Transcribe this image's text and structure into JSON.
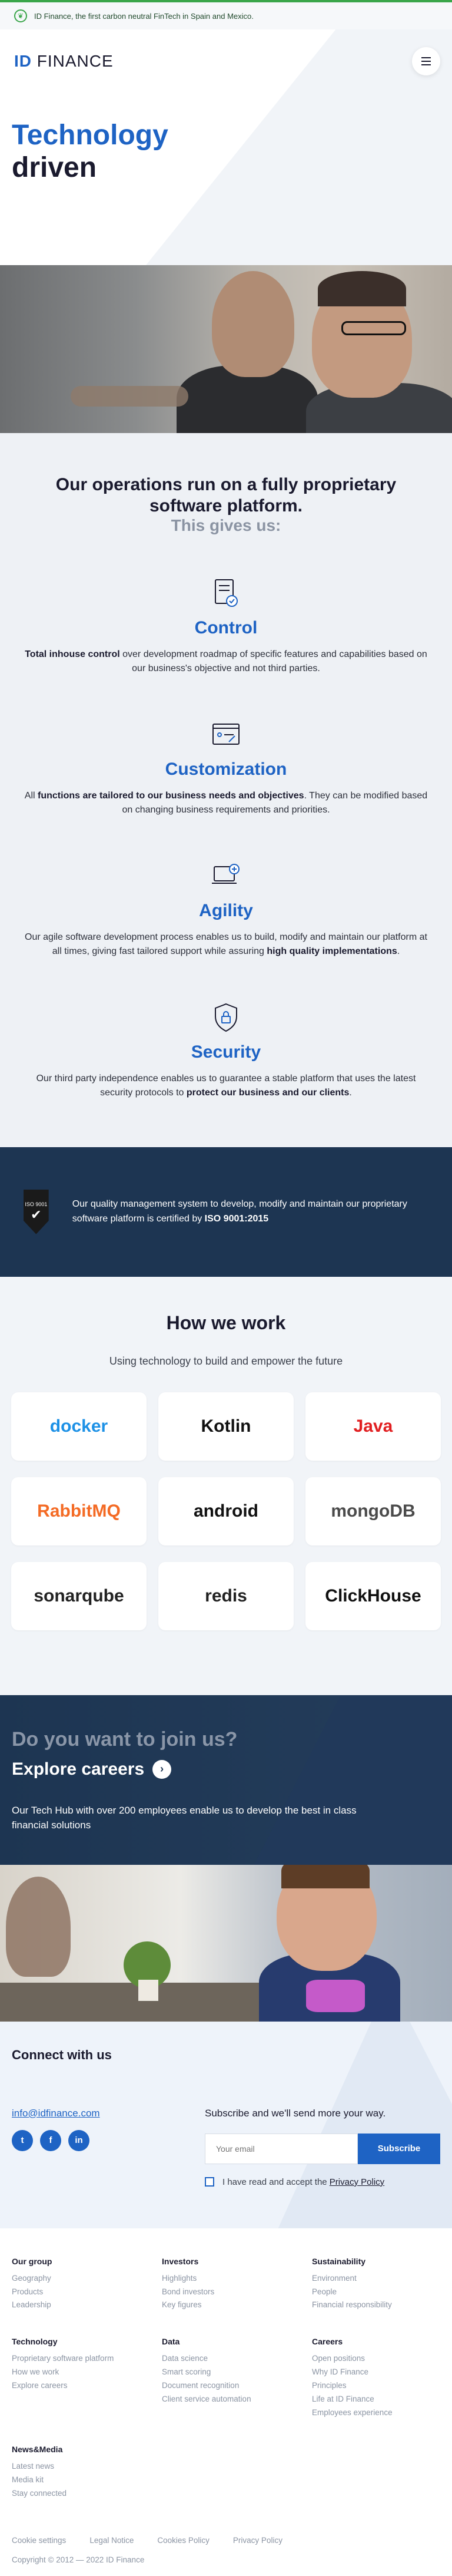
{
  "topbar": {
    "text": "ID Finance, the first carbon neutral FinTech in Spain and Mexico."
  },
  "header": {
    "logo_id": "ID",
    "logo_finance": "FINANCE",
    "title_line1": "Technology",
    "title_line2": "driven"
  },
  "ops": {
    "heading": "Our operations run on a fully proprietary software platform.",
    "subheading": "This gives us:",
    "features": [
      {
        "title": "Control",
        "pre": "",
        "bold1": "Total inhouse control",
        "mid": " over development roadmap of specific features and capabilities based on our business's objective and not third parties.",
        "bold2": "",
        "post": ""
      },
      {
        "title": "Customization",
        "pre": "All ",
        "bold1": "functions are tailored to our business needs and objectives",
        "mid": ". They can be modified based on changing business requirements and priorities.",
        "bold2": "",
        "post": ""
      },
      {
        "title": "Agility",
        "pre": "Our agile software development process enables us to build, modify and maintain our platform at all times, giving fast tailored support while assuring ",
        "bold1": "high quality implementations",
        "mid": ".",
        "bold2": "",
        "post": ""
      },
      {
        "title": "Security",
        "pre": "Our third party independence enables us to guarantee a stable platform that uses the latest security protocols to ",
        "bold1": "protect our business and our clients",
        "mid": ".",
        "bold2": "",
        "post": ""
      }
    ]
  },
  "iso": {
    "badge_text": "ISO 9001",
    "text_pre": "Our quality management system to develop, modify and maintain our proprietary software platform is certified by ",
    "text_bold": "ISO 9001:2015"
  },
  "how": {
    "heading": "How we work",
    "subheading": "Using technology to build and empower the future",
    "tiles": [
      {
        "name": "docker",
        "color": "#1d91e6"
      },
      {
        "name": "Kotlin",
        "color": "#111111"
      },
      {
        "name": "Java",
        "color": "#e11f21"
      },
      {
        "name": "RabbitMQ",
        "color": "#f46b25"
      },
      {
        "name": "android",
        "color": "#111111"
      },
      {
        "name": "mongoDB",
        "color": "#4b4b4b"
      },
      {
        "name": "sonarqube",
        "color": "#222222"
      },
      {
        "name": "redis",
        "color": "#222222"
      },
      {
        "name": "ClickHouse",
        "color": "#111111"
      }
    ]
  },
  "careers": {
    "heading": "Do you want to join us?",
    "link": "Explore careers",
    "text": "Our Tech Hub with over 200 employees enable us to develop the best in class financial solutions"
  },
  "connect": {
    "heading": "Connect with us",
    "email": "info@idfinance.com",
    "socials": [
      "t",
      "f",
      "in"
    ],
    "newsletter_lead": "Subscribe and we'll send more your way.",
    "email_placeholder": "Your email",
    "subscribe_label": "Subscribe",
    "agree_pre": "I have read and accept the ",
    "agree_link": "Privacy Policy"
  },
  "footer": {
    "columns": [
      {
        "title": "Our group",
        "links": [
          "Geography",
          "Products",
          "Leadership"
        ]
      },
      {
        "title": "Investors",
        "links": [
          "Highlights",
          "Bond investors",
          "Key figures"
        ]
      },
      {
        "title": "Sustainability",
        "links": [
          "Environment",
          "People",
          "Financial responsibility"
        ]
      },
      {
        "title": "Technology",
        "links": [
          "Proprietary software platform",
          "How we work",
          "Explore careers"
        ]
      },
      {
        "title": "Data",
        "links": [
          "Data science",
          "Smart scoring",
          "Document recognition",
          "Client service automation"
        ]
      },
      {
        "title": "Careers",
        "links": [
          "Open positions",
          "Why ID Finance",
          "Principles",
          "Life at ID Finance",
          "Employees experience"
        ]
      },
      {
        "title": "News&Media",
        "links": [
          "Latest news",
          "Media kit",
          "Stay connected"
        ]
      }
    ],
    "bottom_links": [
      "Cookie settings",
      "Legal Notice",
      "Cookies Policy",
      "Privacy Policy"
    ],
    "copyright": "Copyright © 2012 — 2022 ID Finance"
  },
  "colors": {
    "brand_blue": "#1e63c4",
    "navy": "#1d3552",
    "green_bar": "#3aa64a"
  }
}
